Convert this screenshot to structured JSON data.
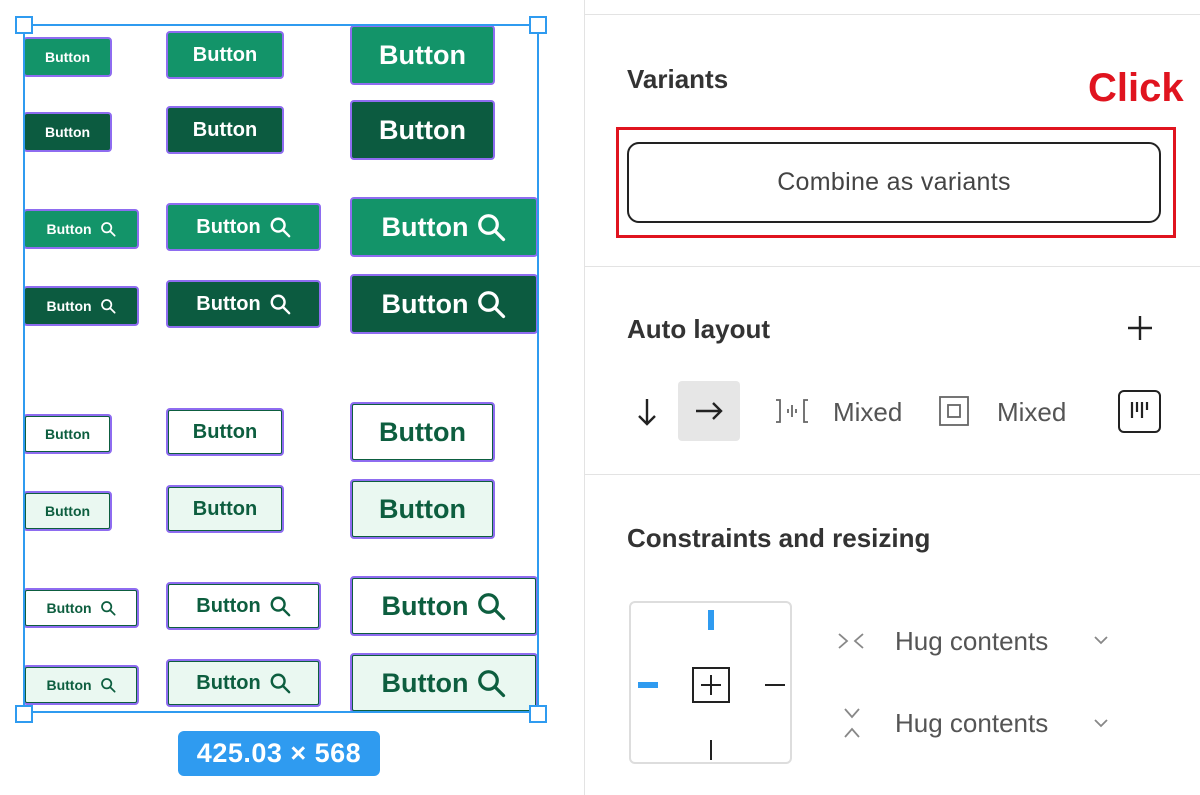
{
  "canvas": {
    "size_badge": "425.03 × 568",
    "button_label": "Button",
    "rows": [
      {
        "variant": "primary",
        "icon": false
      },
      {
        "variant": "dark",
        "icon": false
      },
      {
        "variant": "primary",
        "icon": true
      },
      {
        "variant": "dark",
        "icon": true
      },
      {
        "variant": "outline",
        "icon": false
      },
      {
        "variant": "soft",
        "icon": false
      },
      {
        "variant": "outline",
        "icon": true
      },
      {
        "variant": "soft",
        "icon": true
      }
    ]
  },
  "panel": {
    "variants": {
      "title": "Variants",
      "combine_button": "Combine as variants",
      "annotation": "Click"
    },
    "auto_layout": {
      "title": "Auto layout",
      "spacing_value": "Mixed",
      "padding_value": "Mixed"
    },
    "constraints": {
      "title": "Constraints and resizing",
      "width_mode": "Hug contents",
      "height_mode": "Hug contents"
    }
  },
  "colors": {
    "primary_green": "#139469",
    "dark_green": "#0c5b40",
    "selection_blue": "#2f9bf0",
    "component_outline": "#8e6cf0",
    "annotation_red": "#e0141f"
  }
}
